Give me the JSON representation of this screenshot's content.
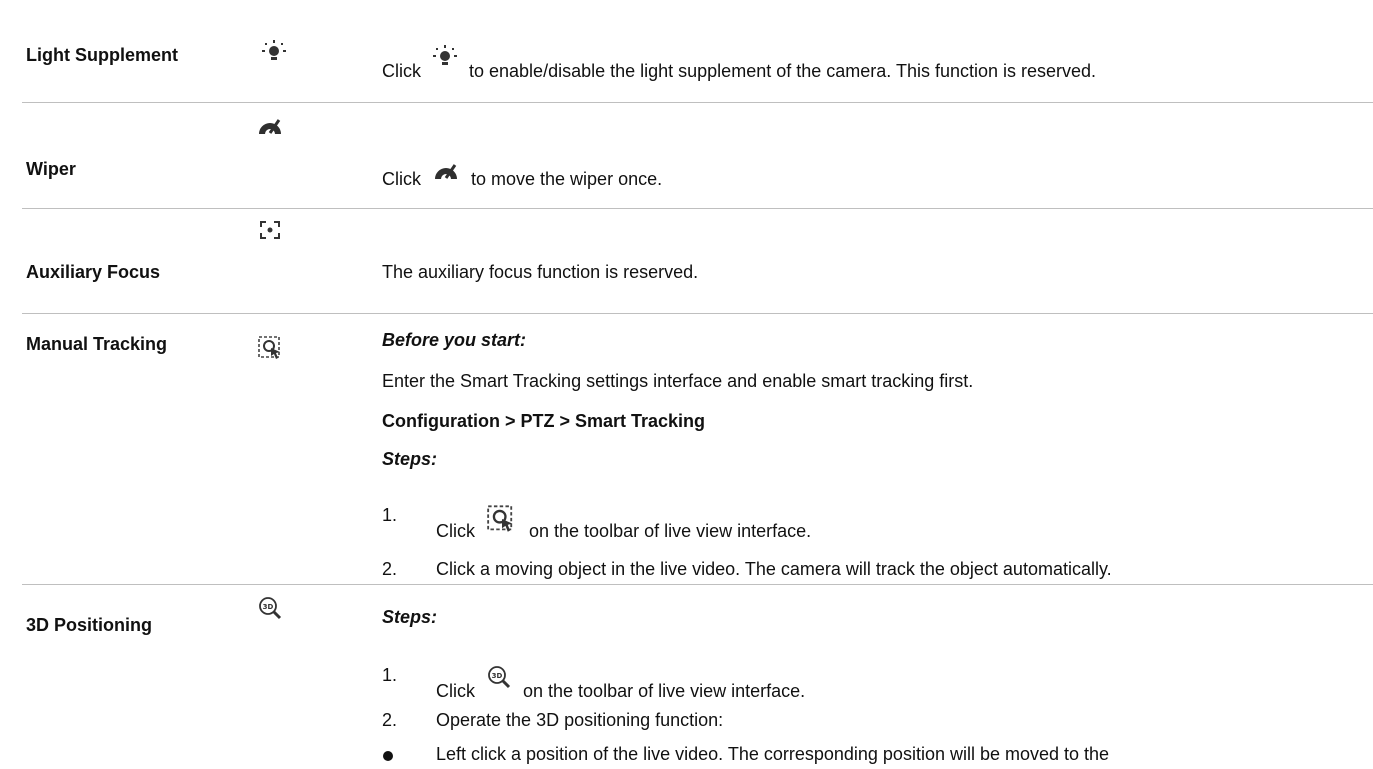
{
  "rows": [
    {
      "name": "Light Supplement",
      "icon": "light-supplement-icon",
      "desc_before": "Click",
      "desc_after": "to enable/disable the light supplement of the camera. This function is reserved."
    },
    {
      "name": "Wiper",
      "icon": "wiper-icon",
      "desc_before": "Click",
      "desc_after": "to move the wiper once."
    },
    {
      "name": "Auxiliary Focus",
      "icon": "auxiliary-focus-icon",
      "desc": "The auxiliary focus function is reserved."
    },
    {
      "name": "Manual Tracking",
      "icon": "manual-tracking-icon",
      "before_label": "Before you start:",
      "before_text": "Enter the Smart Tracking settings interface and enable smart tracking first.",
      "path": "Configuration > PTZ > Smart Tracking",
      "steps_label": "Steps:",
      "steps": [
        {
          "num": "1.",
          "before": "Click",
          "after": "on the toolbar of live view interface."
        },
        {
          "num": "2.",
          "text": "Click a moving object in the live video. The camera will track the object automatically."
        }
      ]
    },
    {
      "name": "3D Positioning",
      "icon": "3d-positioning-icon",
      "steps_label": "Steps:",
      "steps": [
        {
          "num": "1.",
          "before": "Click",
          "after": "on the toolbar of live view interface."
        },
        {
          "num": "2.",
          "text": "Operate the 3D positioning function:"
        }
      ],
      "bullet": "Left click a position of the live video. The corresponding position will be moved to the"
    }
  ]
}
